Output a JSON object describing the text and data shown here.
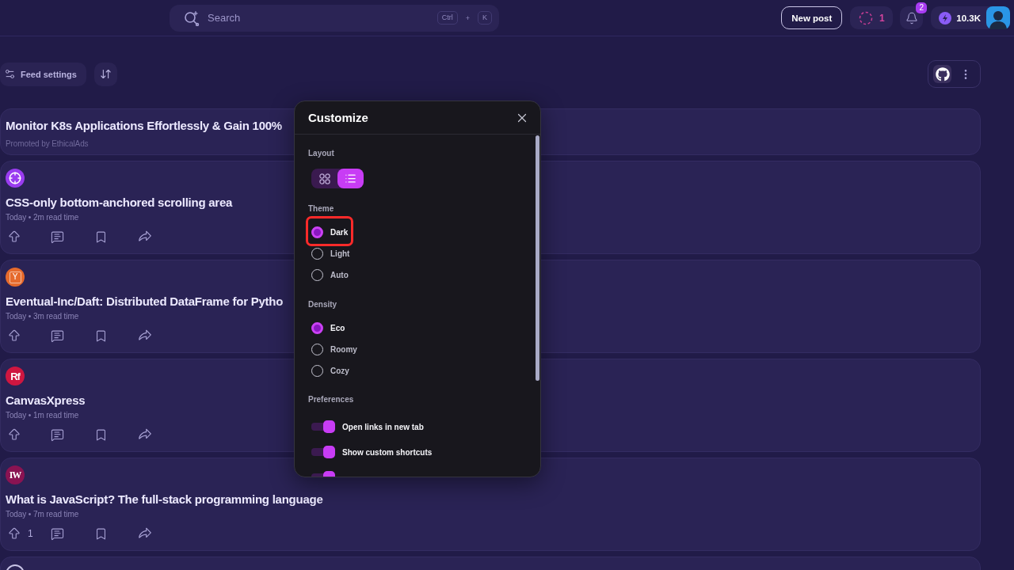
{
  "header": {
    "search": {
      "placeholder": "Search",
      "keys": [
        "Ctrl",
        "K"
      ],
      "joiner": "+"
    },
    "new_post": "New post",
    "streak": "1",
    "notifications": "2",
    "reputation": "10.3K"
  },
  "toolbar": {
    "feed_settings": "Feed settings"
  },
  "feed": [
    {
      "kind": "ad",
      "title": "Monitor K8s Applications Effortlessly & Gain 100%",
      "promoted": "Promoted by EthicalAds"
    },
    {
      "kind": "post",
      "source": {
        "kind": "crosshair",
        "color": "#9a3cf0"
      },
      "title": "CSS-only bottom-anchored scrolling area",
      "meta": "Today • 2m read time"
    },
    {
      "kind": "post",
      "source": {
        "kind": "boxed",
        "label": "Y",
        "color": "#e66a2c"
      },
      "title": "Eventual-Inc/Daft: Distributed DataFrame for Pytho",
      "meta": "Today • 3m read time"
    },
    {
      "kind": "post",
      "source": {
        "kind": "letters",
        "label": "Rf",
        "color": "#cf1640"
      },
      "title": "CanvasXpress",
      "meta": "Today • 1m read time"
    },
    {
      "kind": "post",
      "source": {
        "kind": "serif",
        "label": "IW",
        "color": "#8a1352"
      },
      "title": "What is JavaScript? The full-stack programming language",
      "meta": "Today • 7m read time",
      "upvotes": "1"
    },
    {
      "kind": "post",
      "source": {
        "kind": "ring"
      }
    }
  ],
  "customize": {
    "title": "Customize",
    "layout": {
      "label": "Layout",
      "options": [
        {
          "kind": "grid",
          "selected": false
        },
        {
          "kind": "list",
          "selected": true
        }
      ]
    },
    "theme": {
      "label": "Theme",
      "options": [
        {
          "label": "Dark",
          "selected": true,
          "highlighted": true
        },
        {
          "label": "Light",
          "selected": false,
          "highlighted": false
        },
        {
          "label": "Auto",
          "selected": false,
          "highlighted": false
        }
      ]
    },
    "density": {
      "label": "Density",
      "options": [
        {
          "label": "Eco",
          "selected": true
        },
        {
          "label": "Roomy",
          "selected": false
        },
        {
          "label": "Cozy",
          "selected": false
        }
      ]
    },
    "preferences": {
      "label": "Preferences",
      "items": [
        {
          "label": "Open links in new tab",
          "on": true
        },
        {
          "label": "Show custom shortcuts",
          "on": true
        },
        {
          "on": true
        }
      ]
    }
  }
}
